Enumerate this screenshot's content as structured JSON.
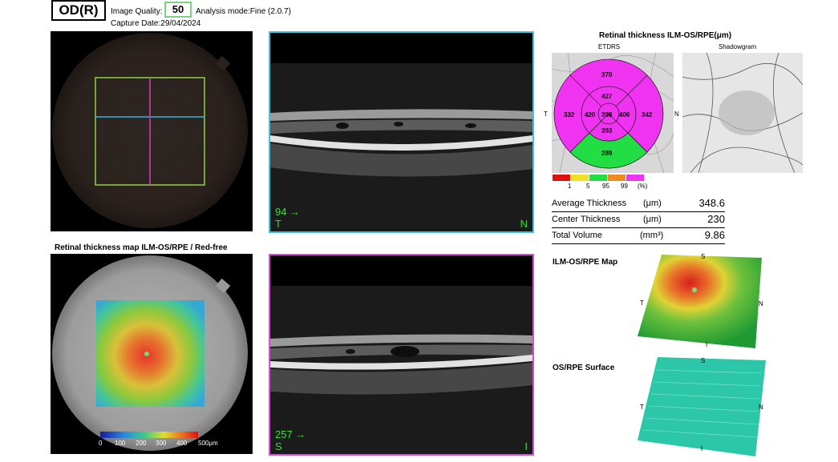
{
  "header": {
    "eye": "OD(R)",
    "image_quality_label": "Image Quality:",
    "image_quality_value": "50",
    "analysis_mode": "Analysis mode:Fine (2.0.7)",
    "capture_date": "Capture Date:29/04/2024"
  },
  "scan_top": {
    "number": "94 →",
    "left": "T",
    "right": "N",
    "border_color": "#3fc4e0"
  },
  "scan_bottom": {
    "number": "257 →",
    "left": "S",
    "right": "I",
    "border_color": "#d94cd9"
  },
  "thickness_map": {
    "title": "Retinal thickness map ILM-OS/RPE / Red-free",
    "scale_ticks": [
      "0",
      "100",
      "200",
      "300",
      "400",
      "500μm"
    ]
  },
  "etdrs": {
    "title": "Retinal thickness ILM-OS/RPE(μm)",
    "etdrs_label": "ETDRS",
    "shadowgram_label": "Shadowgram",
    "side_t": "T",
    "side_n": "N",
    "values": {
      "outer_superior": "370",
      "outer_temporal": "332",
      "outer_nasal": "342",
      "outer_inferior": "289",
      "inner_superior": "427",
      "inner_temporal": "420",
      "inner_nasal": "406",
      "inner_inferior": "393",
      "center": "398"
    },
    "colors": {
      "normal": "#f033f0",
      "low": "#22dd44"
    },
    "legend_colors": [
      "#e01010",
      "#f0e020",
      "#22dd44",
      "#f08a20",
      "#f033f0"
    ],
    "legend_ticks": [
      "1",
      "5",
      "95",
      "99",
      "(%)"
    ]
  },
  "measurements": [
    {
      "label": "Average Thickness",
      "unit": "(μm)",
      "value": "348.6"
    },
    {
      "label": "Center Thickness",
      "unit": "(μm)",
      "value": "230"
    },
    {
      "label": "Total Volume",
      "unit": "(mm³)",
      "value": "9.86"
    }
  ],
  "map3d": {
    "ilm_title": "ILM-OS/RPE Map",
    "os_title": "OS/RPE Surface",
    "s": "S",
    "t": "T",
    "n": "N",
    "i": "I"
  }
}
